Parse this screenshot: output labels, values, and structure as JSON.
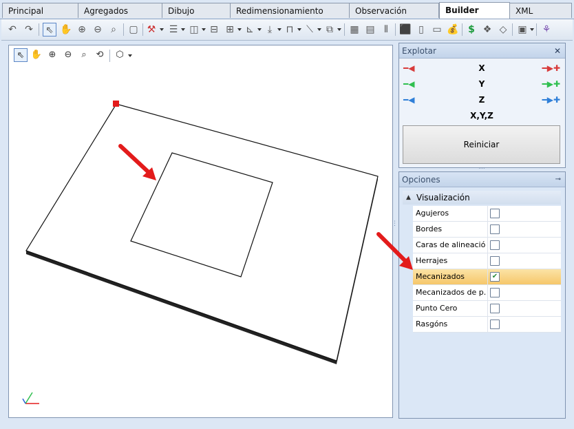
{
  "tabs": [
    {
      "label": "Principal"
    },
    {
      "label": "Agregados"
    },
    {
      "label": "Dibujo"
    },
    {
      "label": "Redimensionamiento"
    },
    {
      "label": "Observación"
    },
    {
      "label": "Builder"
    },
    {
      "label": "XML"
    }
  ],
  "active_tab": "Builder",
  "explode_panel": {
    "title": "Explotar",
    "axes": [
      "X",
      "Y",
      "Z"
    ],
    "all_axes_label": "X,Y,Z",
    "reset_label": "Reiniciar",
    "colors": {
      "x": "#d83b3b",
      "y": "#2fbf4f",
      "z": "#2f7fd8"
    }
  },
  "options_panel": {
    "title": "Opciones",
    "group_label": "Visualización",
    "items": [
      {
        "label": "Agujeros",
        "checked": false
      },
      {
        "label": "Bordes",
        "checked": false
      },
      {
        "label": "Caras de alineación",
        "checked": false
      },
      {
        "label": "Herrajes",
        "checked": false
      },
      {
        "label": "Mecanizados",
        "checked": true
      },
      {
        "label": "Mecanizados de p...",
        "checked": false
      },
      {
        "label": "Punto Cero",
        "checked": false
      },
      {
        "label": "Rasgóns",
        "checked": false
      }
    ]
  },
  "close_glyph": "✕",
  "pin_glyph": "📌",
  "collapse_glyph": "▲"
}
